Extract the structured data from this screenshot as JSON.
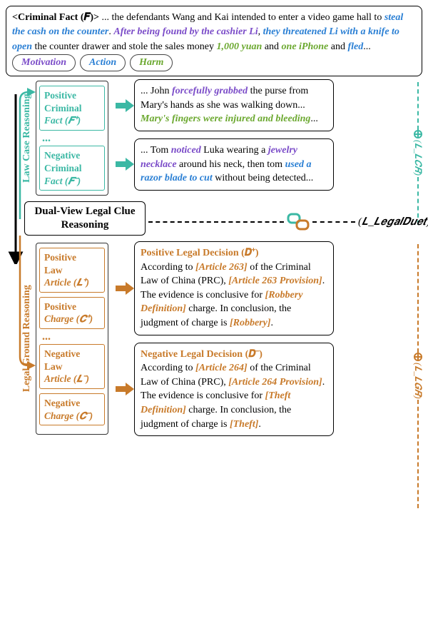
{
  "fact": {
    "title": "<Criminal Fact (𝑭)>",
    "p1": " ... the defendants Wang and Kai intended to enter a video game hall to ",
    "m1": "steal the cash on the counter",
    "p2": ". ",
    "m2": "After being found by the cashier Li",
    "p3": ", ",
    "a1": "they threatened Li with a knife to open",
    "p4": " the counter drawer and stole the sales money ",
    "h1": "1,000 yuan",
    "p5": " and ",
    "h2": "one iPhone",
    "p6": " and ",
    "a2": "fled",
    "p7": "...  "
  },
  "legend": {
    "m": "Motivation",
    "a": "Action",
    "h": "Harm"
  },
  "lcr": {
    "vlabel": "Law Case Reasoning",
    "pos_box_l1": "Positive",
    "pos_box_l2": "Criminal",
    "pos_box_l3": "Fact (𝑭⁺)",
    "neg_box_l1": "Negative",
    "neg_box_l2": "Criminal",
    "neg_box_l3": "Fact (𝑭⁻)",
    "dots": "...",
    "pos_case_p1": "... John ",
    "pos_case_a1": "forcefully grabbed",
    "pos_case_p2": " the purse from Mary's hands as she was walking down... ",
    "pos_case_h1": "Mary's fingers were injured and bleeding",
    "pos_case_p3": "...",
    "neg_case_p1": "... Tom ",
    "neg_case_m1": "noticed",
    "neg_case_p2": " Luka wearing a ",
    "neg_case_m2": "jewelry necklace",
    "neg_case_p3": " around his neck, then tom ",
    "neg_case_a1": "used a razor blade to cut",
    "neg_case_p4": " without being detected...",
    "loss": "(𝑳_𝑳𝑪𝑹)"
  },
  "dualview": "Dual-View Legal Clue Reasoning",
  "lgr": {
    "vlabel": "Legal Ground Reasoning",
    "pos_law_l1": "Positive",
    "pos_law_l2": "Law",
    "pos_law_l3": "Article (𝑳⁺)",
    "pos_chg_l1": "Positive",
    "pos_chg_l2": "Charge (𝑪⁺)",
    "neg_law_l1": "Negative",
    "neg_law_l2": "Law",
    "neg_law_l3": "Article (𝑳⁻)",
    "neg_chg_l1": "Negative",
    "neg_chg_l2": "Charge (𝑪⁻)",
    "dots": "...",
    "pos_dec_title": "Positive Legal Decision (𝑫⁺)",
    "pos_dec_p1": "According to ",
    "pos_dec_b1": "[Article 263]",
    "pos_dec_p2": " of the Criminal Law of China (PRC), ",
    "pos_dec_b2": "[Article 263 Provision]",
    "pos_dec_p3": ". The evidence is conclusive for ",
    "pos_dec_b3": "[Robbery Definition]",
    "pos_dec_p4": " charge. In conclusion, the judgment of charge is ",
    "pos_dec_b4": "[Robbery]",
    "pos_dec_p5": ".",
    "neg_dec_title": "Negative Legal Decision (𝑫⁻)",
    "neg_dec_p1": "According to ",
    "neg_dec_b1": "[Article 264]",
    "neg_dec_p2": " of the Criminal Law of China (PRC), ",
    "neg_dec_b2": "[Article 264 Provision]",
    "neg_dec_p3": ". The evidence is conclusive for ",
    "neg_dec_b3": "[Theft Definition]",
    "neg_dec_p4": " charge. In conclusion, the judgment of charge is ",
    "neg_dec_b4": "[Theft]",
    "neg_dec_p5": ".",
    "loss": "(𝑳_𝑳𝑮𝑹)"
  },
  "legalduet_loss": "(𝑳_𝑳𝒆𝒈𝒂𝒍𝑫𝒖𝒆𝒕)"
}
